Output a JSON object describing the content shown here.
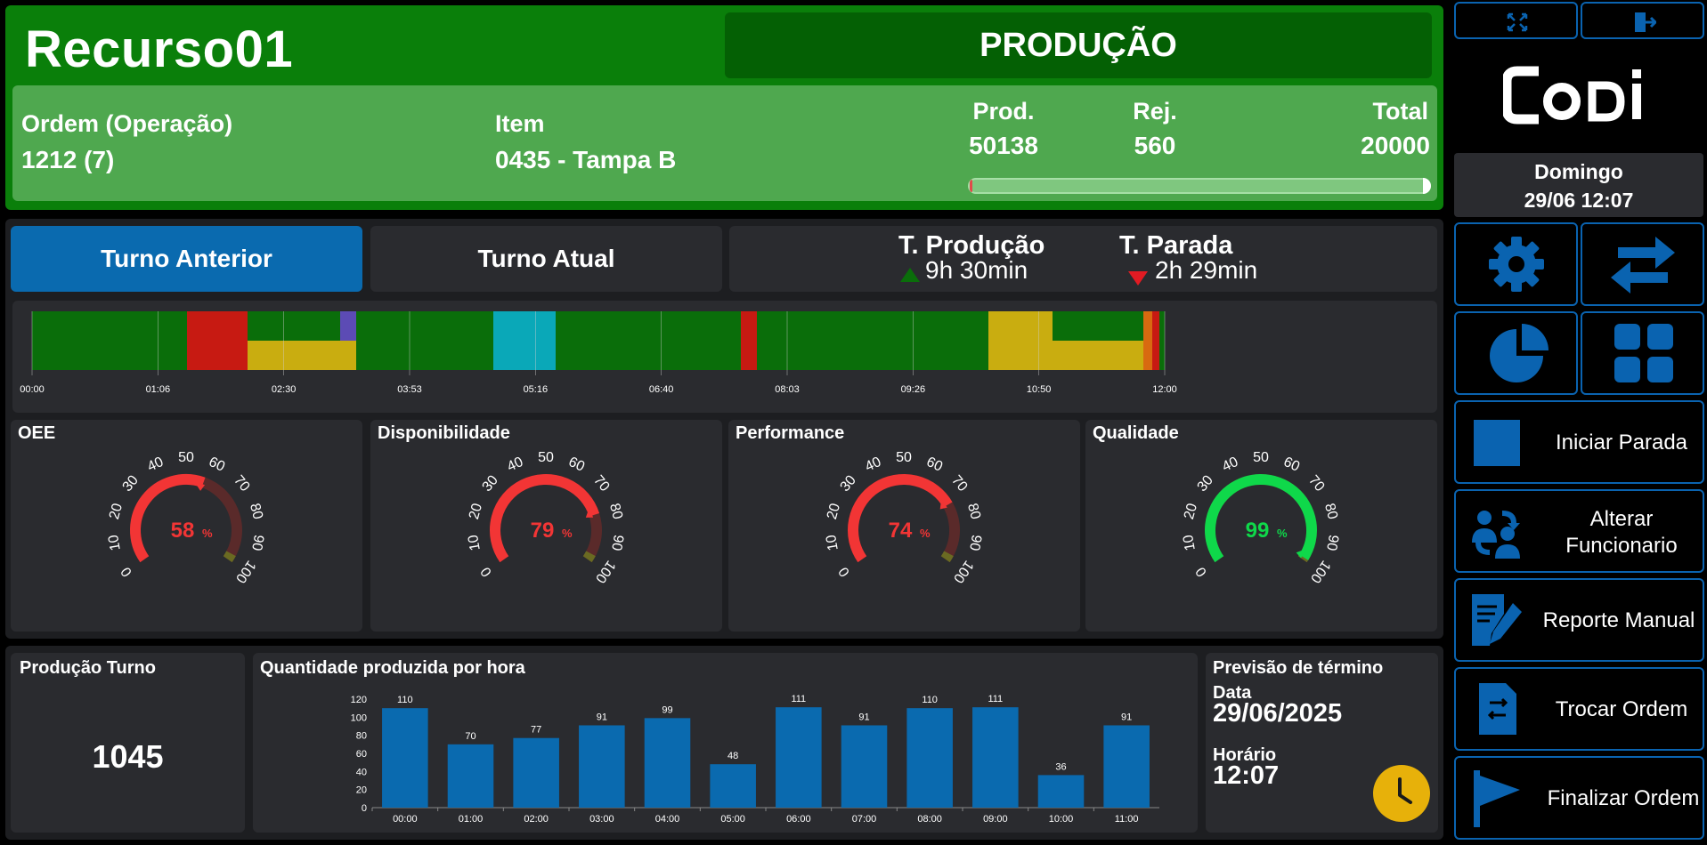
{
  "header": {
    "resource": "Recurso01",
    "status": "PRODUÇÃO",
    "order_label": "Ordem (Operação)",
    "order_value": "1212 (7)",
    "item_label": "Item",
    "item_value": "0435 - Tampa B",
    "prod_label": "Prod.",
    "prod_value": "50138",
    "rej_label": "Rej.",
    "rej_value": "560",
    "total_label": "Total",
    "total_value": "20000",
    "progress_fraction": 0.005
  },
  "tabs": {
    "previous": "Turno Anterior",
    "current": "Turno Atual",
    "prod_time_label": "T. Produção",
    "prod_time_value": "9h 30min",
    "stop_time_label": "T. Parada",
    "stop_time_value": "2h 29min"
  },
  "timeline": {
    "ticks": [
      "00:00",
      "01:06",
      "02:30",
      "03:53",
      "05:16",
      "06:40",
      "08:03",
      "09:26",
      "10:50",
      "12:00"
    ],
    "colors": {
      "production": "#0a6e0a",
      "stop_red": "#c71a12",
      "stop_yellow": "#c9ad10",
      "stop_purple": "#5c4bb5",
      "stop_cyan": "#0aa8b8",
      "stop_orange": "#d86a10"
    }
  },
  "gauges": [
    {
      "title": "OEE",
      "value": 58,
      "unit": "%",
      "color": "#f23535"
    },
    {
      "title": "Disponibilidade",
      "value": 79,
      "unit": "%",
      "color": "#f23535"
    },
    {
      "title": "Performance",
      "value": 74,
      "unit": "%",
      "color": "#f23535"
    },
    {
      "title": "Qualidade",
      "value": 99,
      "unit": "%",
      "color": "#0fd84a"
    }
  ],
  "gauge_scale": [
    "0",
    "10",
    "20",
    "30",
    "40",
    "50",
    "60",
    "70",
    "80",
    "90",
    "100"
  ],
  "production_shift": {
    "title": "Produção Turno",
    "value": "1045"
  },
  "hourly": {
    "title": "Quantidade produzida por hora"
  },
  "chart_data": {
    "type": "bar",
    "categories": [
      "00:00",
      "01:00",
      "02:00",
      "03:00",
      "04:00",
      "05:00",
      "06:00",
      "07:00",
      "08:00",
      "09:00",
      "10:00",
      "11:00"
    ],
    "values": [
      110,
      70,
      77,
      91,
      99,
      48,
      111,
      91,
      110,
      111,
      36,
      91
    ],
    "yticks": [
      "0",
      "20",
      "40",
      "60",
      "80",
      "100",
      "120"
    ],
    "ylim": [
      0,
      120
    ],
    "title": "Quantidade produzida por hora",
    "color": "#0a6aaf"
  },
  "forecast": {
    "title": "Previsão de término",
    "date_label": "Data",
    "date_value": "29/06/2025",
    "time_label": "Horário",
    "time_value": "12:07"
  },
  "sidebar": {
    "day": "Domingo",
    "datetime": "29/06 12:07",
    "logo": "Codi",
    "buttons": {
      "start_stop": "Iniciar Parada",
      "change_employee_1": "Alterar",
      "change_employee_2": "Funcionario",
      "manual_report": "Reporte Manual",
      "change_order": "Trocar Ordem",
      "finish_order": "Finalizar Ordem"
    }
  }
}
